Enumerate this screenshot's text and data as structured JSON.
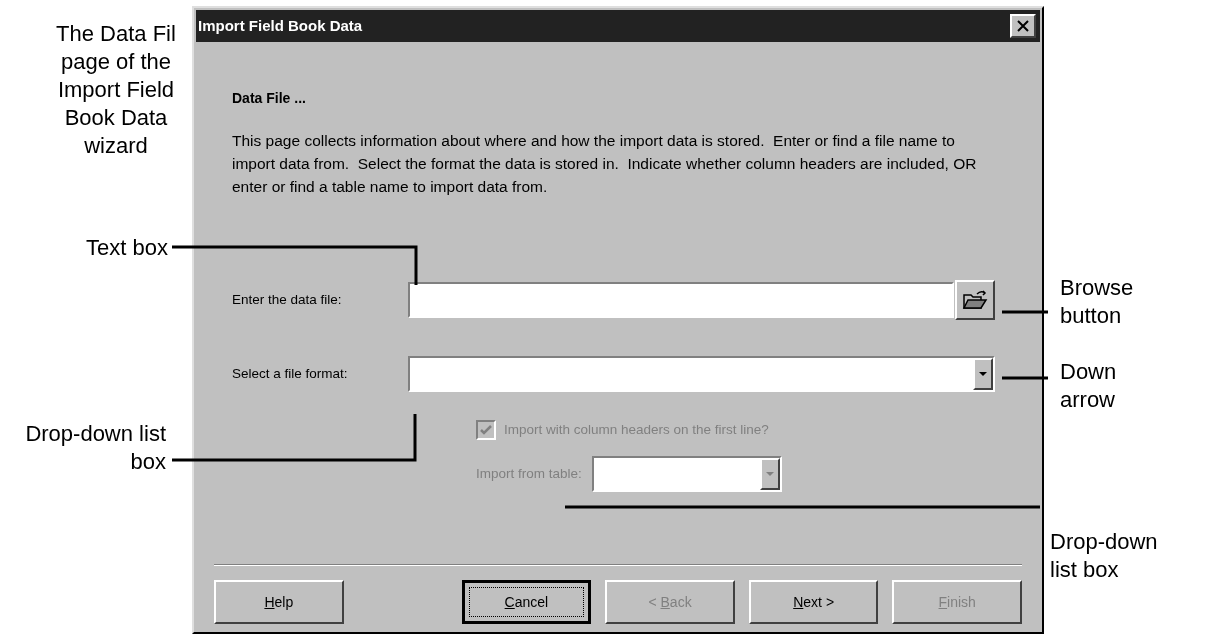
{
  "caption": "The Data Fil page of the Import Field Book Data wizard",
  "callouts": [
    {
      "text": "Text box"
    },
    {
      "text": "Browse button"
    },
    {
      "text": "Down arrow"
    },
    {
      "text": "Drop-down list box"
    },
    {
      "text": "Drop-down list box"
    }
  ],
  "dialog": {
    "title": "Import Field Book Data",
    "heading": "Data File ...",
    "description": "This page collects information about where and how the import data is stored.  Enter or find a file name to import data from.  Select the format the data is stored in.  Indicate whether column headers are included, OR enter or find a table name to import data from.",
    "fields": [
      {
        "kind": "browse",
        "label": "Enter the data file:"
      },
      {
        "kind": "dropdown",
        "label": "Select a file format:"
      }
    ],
    "checkbox": {
      "label": "Import with column headers on the first line?",
      "checked": true,
      "disabled": true
    },
    "table_field": {
      "label": "Import from table:",
      "disabled": true
    },
    "buttons": [
      {
        "access_key": "H",
        "rest": "elp",
        "disabled": false,
        "focused": false
      },
      {
        "access_key": "C",
        "rest": "ancel",
        "disabled": false,
        "focused": true
      },
      {
        "prefix": "< ",
        "access_key": "B",
        "rest": "ack",
        "disabled": true,
        "focused": false
      },
      {
        "access_key": "N",
        "rest": "ext >",
        "disabled": false,
        "focused": false
      },
      {
        "access_key": "F",
        "rest": "inish",
        "disabled": true,
        "focused": false
      }
    ]
  }
}
